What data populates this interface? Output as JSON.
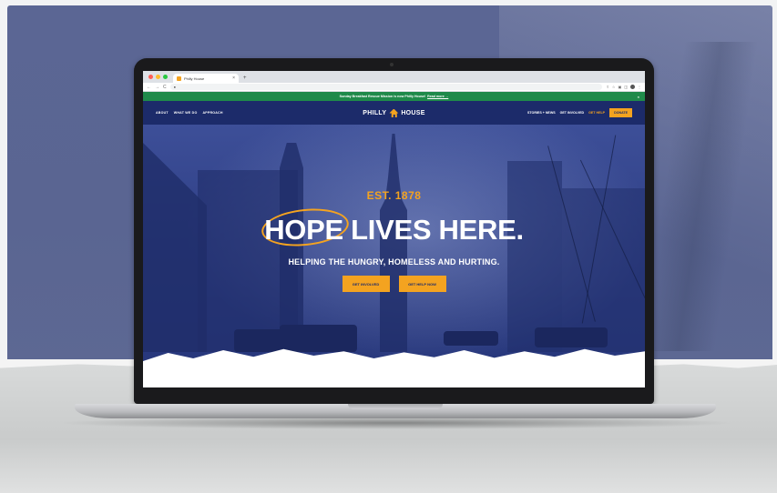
{
  "browser": {
    "tab_title": "Philly House",
    "tab_close": "×",
    "new_tab": "+",
    "nav_back": "←",
    "nav_forward": "→",
    "nav_reload": "C"
  },
  "site": {
    "announcement": {
      "text": "Sunday Breakfast Rescue Mission is now Philly House!",
      "link": "Read more →",
      "close": "×"
    },
    "nav": {
      "left": [
        "ABOUT",
        "WHAT WE DO",
        "APPROACH"
      ],
      "logo_text_left": "PHILLY",
      "logo_text_right": "HOUSE",
      "right": [
        "STORIES + NEWS",
        "GET INVOLVED"
      ],
      "get_help": "GET HELP",
      "donate": "DONATE"
    },
    "hero": {
      "est": "EST. 1878",
      "headline": "HOPE LIVES HERE.",
      "subheadline": "HELPING THE HUNGRY, HOMELESS AND HURTING.",
      "buttons": [
        "GET INVOLVED",
        "GET HELP NOW"
      ]
    }
  },
  "colors": {
    "brand_navy": "#1c2b6a",
    "brand_orange": "#f4a320",
    "announce_green": "#1f8a4a",
    "wall": "#5b6694"
  }
}
